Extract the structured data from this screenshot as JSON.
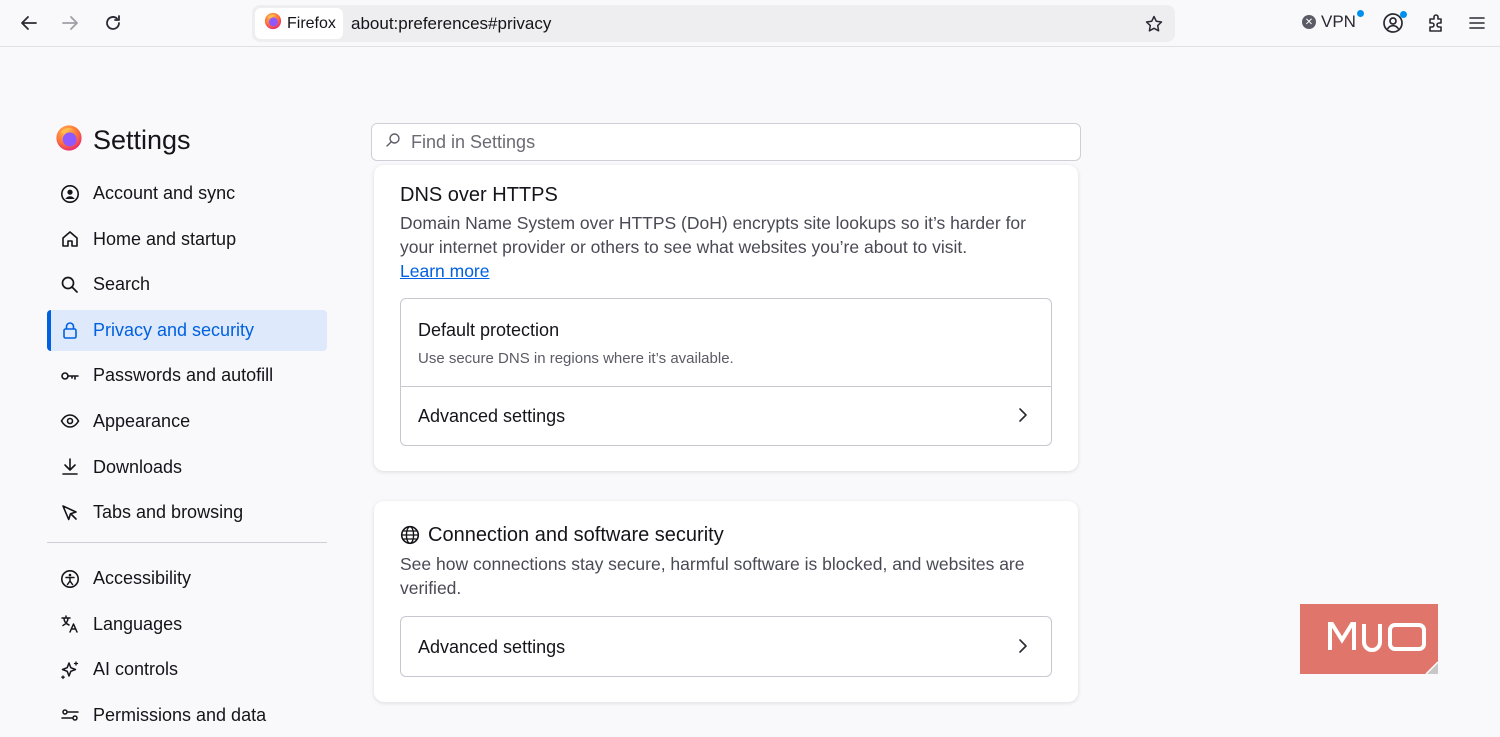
{
  "toolbar": {
    "identity_label": "Firefox",
    "url": "about:preferences#privacy",
    "vpn_label": "VPN",
    "icons": [
      "back-icon",
      "forward-icon",
      "reload-icon",
      "bookmark-star-icon",
      "account-icon",
      "extensions-icon",
      "menu-icon"
    ]
  },
  "sidebar": {
    "title": "Settings",
    "items": [
      {
        "label": "Account and sync",
        "icon": "account-icon"
      },
      {
        "label": "Home and startup",
        "icon": "home-icon"
      },
      {
        "label": "Search",
        "icon": "search-icon"
      },
      {
        "label": "Privacy and security",
        "icon": "lock-icon",
        "active": true
      },
      {
        "label": "Passwords and autofill",
        "icon": "key-icon"
      },
      {
        "label": "Appearance",
        "icon": "eye-icon"
      },
      {
        "label": "Downloads",
        "icon": "download-icon"
      },
      {
        "label": "Tabs and browsing",
        "icon": "cursor-icon"
      }
    ],
    "items2": [
      {
        "label": "Accessibility",
        "icon": "accessibility-icon"
      },
      {
        "label": "Languages",
        "icon": "translate-icon"
      },
      {
        "label": "AI controls",
        "icon": "sparkle-icon"
      },
      {
        "label": "Permissions and data",
        "icon": "sliders-icon"
      }
    ]
  },
  "search": {
    "placeholder": "Find in Settings"
  },
  "dns": {
    "title": "DNS over HTTPS",
    "description": "Domain Name System over HTTPS (DoH) encrypts site lookups so it’s harder for your internet provider or others to see what websites you’re about to visit.",
    "learn_more": "Learn more",
    "option_title": "Default protection",
    "option_subtitle": "Use secure DNS in regions where it’s available.",
    "advanced_label": "Advanced settings"
  },
  "connection": {
    "title": "Connection and software security",
    "description": "See how connections stay secure, harmful software is blocked, and websites are verified.",
    "advanced_label": "Advanced settings"
  },
  "watermark": {
    "text": "MUO",
    "color": "#e0756c"
  },
  "colors": {
    "accent": "#0061e0",
    "active_bg": "#deeafc",
    "page_bg": "#f9f9fb"
  }
}
